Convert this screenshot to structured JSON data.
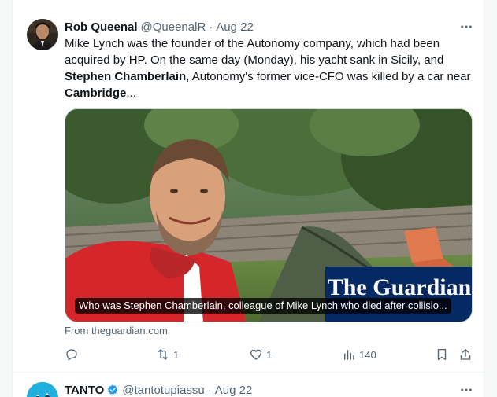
{
  "colors": {
    "text_primary": "#0f1419",
    "text_secondary": "#536471",
    "border": "#eff3f4",
    "verified_blue": "#1d9bf0"
  },
  "tweet1": {
    "author_name": "Rob Queenal",
    "handle": "@QueenalR",
    "separator": "·",
    "date": "Aug 22",
    "more_icon": "ellipsis-icon",
    "text": {
      "p1": "Mike Lynch was the founder of the Autonomy company, which had been acquired by HP. On the same day (Monday), his yacht sank in Sicily, and ",
      "bold1": "Stephen Chamberlain",
      "p2": ", Autonomy's former vice-CFO was killed by a car near ",
      "bold2": "Cambridge",
      "p3": "..."
    },
    "card": {
      "image_desc_icon": "guardian-photo",
      "watermark": "The Guardian",
      "caption": "Who was Stephen Chamberlain, colleague of Mike Lynch who died after collisio...",
      "source": "From theguardian.com"
    },
    "actions": {
      "reply_icon": "reply-icon",
      "reply_count": "",
      "retweet_icon": "retweet-icon",
      "retweet_count": "1",
      "like_icon": "heart-icon",
      "like_count": "1",
      "views_icon": "views-icon",
      "views_count": "140",
      "bookmark_icon": "bookmark-icon",
      "share_icon": "share-icon"
    }
  },
  "tweet2": {
    "author_name": "TANTO",
    "verified": true,
    "handle": "@tantotupiassu",
    "separator": "·",
    "date": "Aug 22",
    "more_icon": "ellipsis-icon"
  }
}
